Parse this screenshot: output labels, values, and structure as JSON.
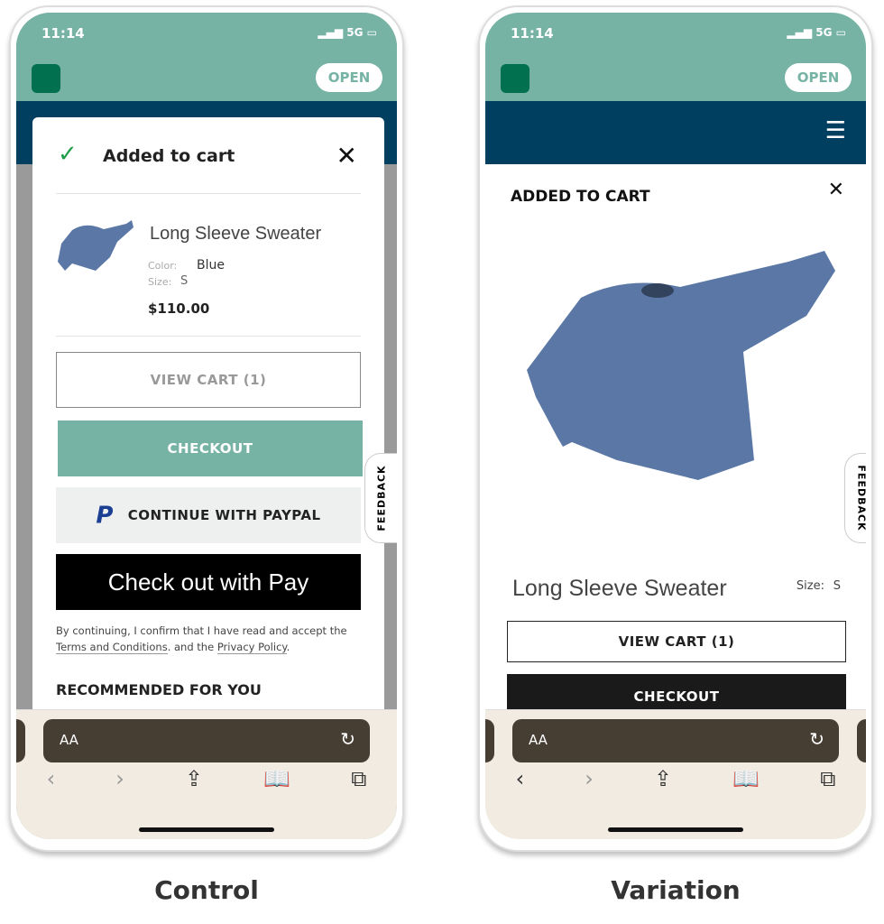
{
  "status": {
    "time": "11:14",
    "signal": "5G"
  },
  "open_label": "OPEN",
  "control": {
    "caption": "Control",
    "modal": {
      "title": "Added to cart",
      "product": "Long Sleeve Sweater",
      "color_label": "Color:",
      "color": "Blue",
      "size_label": "Size:",
      "size": "S",
      "price": "$110.00",
      "view_cart": "VIEW CART (1)",
      "checkout": "CHECKOUT",
      "paypal": "CONTINUE WITH PAYPAL",
      "applepay": "Check out with",
      "applepay_suffix": "Pay",
      "terms_prefix": "By continuing, I confirm that I have read and accept the",
      "terms_link": "Terms and Conditions",
      "terms_mid": ". and the",
      "privacy_link": "Privacy Policy",
      "recommended": "RECOMMENDED FOR YOU"
    }
  },
  "variation": {
    "caption": "Variation",
    "modal": {
      "title": "ADDED TO CART",
      "product": "Long Sleeve Sweater",
      "size_label": "Size:",
      "size": "S",
      "view_cart": "VIEW CART (1)",
      "checkout": "CHECKOUT"
    }
  },
  "feedback": "FEEDBACK",
  "browser": {
    "aa": "AA"
  },
  "colors": {
    "teal": "#77b3a5",
    "navy": "#003f60",
    "logo": "#00704f",
    "check": "#1f9d4a"
  }
}
